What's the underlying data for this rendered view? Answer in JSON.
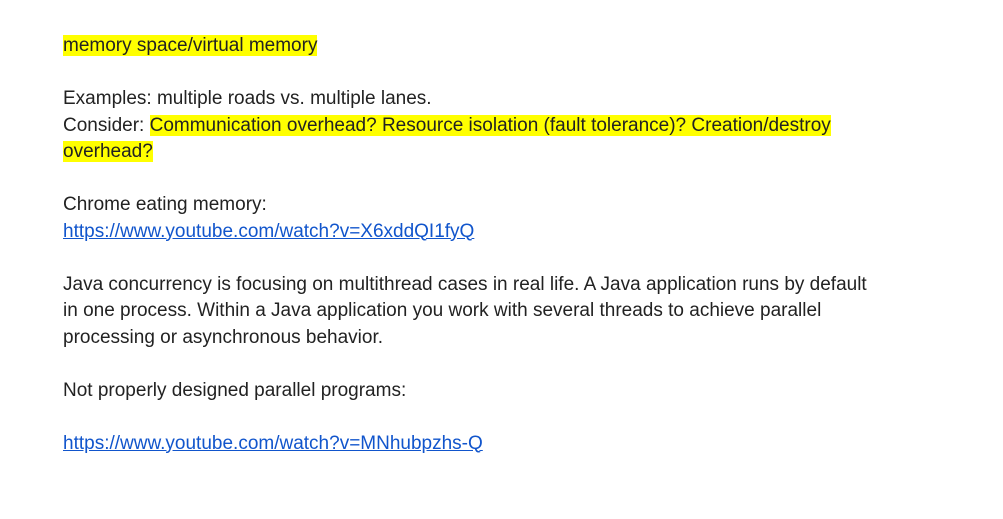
{
  "document": {
    "memory_line": "memory space/virtual memory",
    "examples_line": "Examples: multiple roads vs. multiple lanes.",
    "consider_prefix": "Consider: ",
    "consider_highlight_1": "Communication overhead? Resource isolation (fault tolerance)? Creation/destroy",
    "consider_highlight_2": "overhead?",
    "chrome_label": "Chrome eating memory:",
    "chrome_link": "https://www.youtube.com/watch?v=X6xddQI1fyQ",
    "java_line_1": "Java concurrency is focusing on multithread cases in real life. A Java application runs by default",
    "java_line_2": "in one process. Within a Java application you work with several threads to achieve parallel",
    "java_line_3": "processing or asynchronous behavior.",
    "parallel_label": "Not properly designed parallel programs:",
    "parallel_link": "https://www.youtube.com/watch?v=MNhubpzhs-Q",
    "colors": {
      "highlight": "#ffff00",
      "link": "#1155cc",
      "text": "#222222"
    }
  }
}
